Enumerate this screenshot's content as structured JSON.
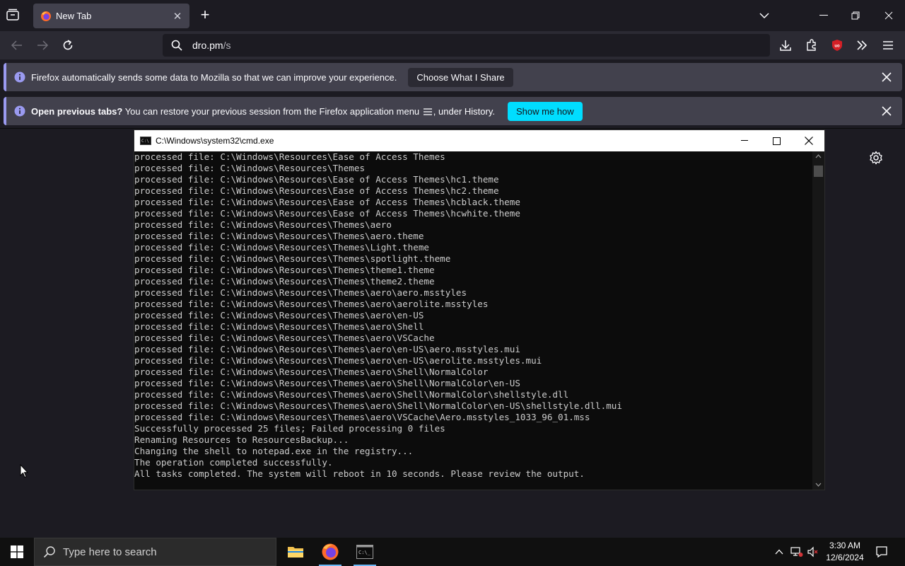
{
  "browser": {
    "tab": {
      "title": "New Tab"
    },
    "url": {
      "host": "dro.pm",
      "path": "/s"
    },
    "notifications": [
      {
        "message": "Firefox automatically sends some data to Mozilla so that we can improve your experience.",
        "button": "Choose What I Share"
      },
      {
        "bold": "Open previous tabs?",
        "message": "You can restore your previous session from the Firefox application menu",
        "suffix": ", under History.",
        "button": "Show me how"
      }
    ]
  },
  "cmd": {
    "title": "C:\\Windows\\system32\\cmd.exe",
    "lines": [
      "processed file: C:\\Windows\\Resources\\Ease of Access Themes",
      "processed file: C:\\Windows\\Resources\\Themes",
      "processed file: C:\\Windows\\Resources\\Ease of Access Themes\\hc1.theme",
      "processed file: C:\\Windows\\Resources\\Ease of Access Themes\\hc2.theme",
      "processed file: C:\\Windows\\Resources\\Ease of Access Themes\\hcblack.theme",
      "processed file: C:\\Windows\\Resources\\Ease of Access Themes\\hcwhite.theme",
      "processed file: C:\\Windows\\Resources\\Themes\\aero",
      "processed file: C:\\Windows\\Resources\\Themes\\aero.theme",
      "processed file: C:\\Windows\\Resources\\Themes\\Light.theme",
      "processed file: C:\\Windows\\Resources\\Themes\\spotlight.theme",
      "processed file: C:\\Windows\\Resources\\Themes\\theme1.theme",
      "processed file: C:\\Windows\\Resources\\Themes\\theme2.theme",
      "processed file: C:\\Windows\\Resources\\Themes\\aero\\aero.msstyles",
      "processed file: C:\\Windows\\Resources\\Themes\\aero\\aerolite.msstyles",
      "processed file: C:\\Windows\\Resources\\Themes\\aero\\en-US",
      "processed file: C:\\Windows\\Resources\\Themes\\aero\\Shell",
      "processed file: C:\\Windows\\Resources\\Themes\\aero\\VSCache",
      "processed file: C:\\Windows\\Resources\\Themes\\aero\\en-US\\aero.msstyles.mui",
      "processed file: C:\\Windows\\Resources\\Themes\\aero\\en-US\\aerolite.msstyles.mui",
      "processed file: C:\\Windows\\Resources\\Themes\\aero\\Shell\\NormalColor",
      "processed file: C:\\Windows\\Resources\\Themes\\aero\\Shell\\NormalColor\\en-US",
      "processed file: C:\\Windows\\Resources\\Themes\\aero\\Shell\\NormalColor\\shellstyle.dll",
      "processed file: C:\\Windows\\Resources\\Themes\\aero\\Shell\\NormalColor\\en-US\\shellstyle.dll.mui",
      "processed file: C:\\Windows\\Resources\\Themes\\aero\\VSCache\\Aero.msstyles_1033_96_01.mss",
      "Successfully processed 25 files; Failed processing 0 files",
      "Renaming Resources to ResourcesBackup...",
      "Changing the shell to notepad.exe in the registry...",
      "The operation completed successfully.",
      "All tasks completed. The system will reboot in 10 seconds. Please review the output."
    ]
  },
  "taskbar": {
    "search_placeholder": "Type here to search",
    "time": "3:30 AM",
    "date": "12/6/2024"
  },
  "colors": {
    "accent_button": "#00ddff",
    "notif_stripe": "#9a9af0",
    "taskbar_indicator": "#6cb8f6"
  }
}
